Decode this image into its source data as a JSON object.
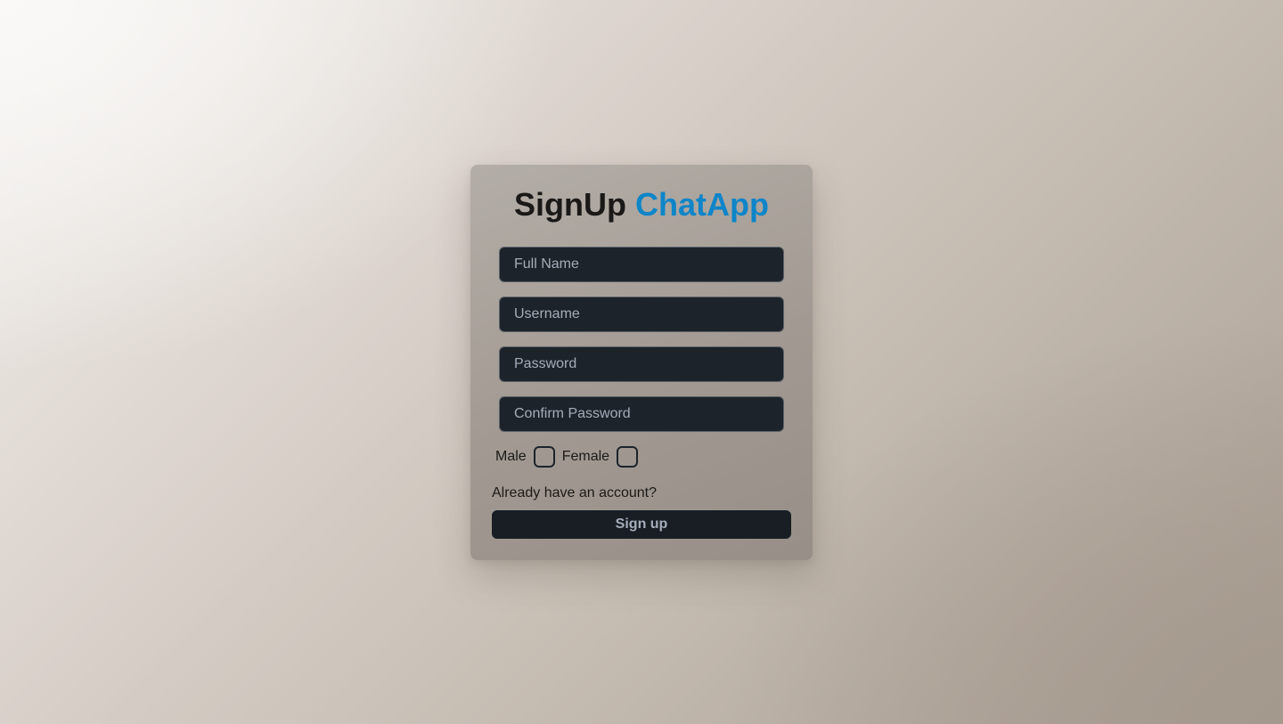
{
  "form": {
    "title_prefix": "SignUp",
    "title_accent": "ChatApp",
    "fields": {
      "full_name_placeholder": "Full Name",
      "username_placeholder": "Username",
      "password_placeholder": "Password",
      "confirm_password_placeholder": "Confirm Password"
    },
    "gender": {
      "male_label": "Male",
      "female_label": "Female",
      "male_checked": false,
      "female_checked": false
    },
    "login_link": "Already have an account?",
    "submit_label": "Sign up"
  },
  "colors": {
    "accent": "#0e85c8",
    "input_bg": "#1d232a",
    "button_bg": "#191e24"
  }
}
